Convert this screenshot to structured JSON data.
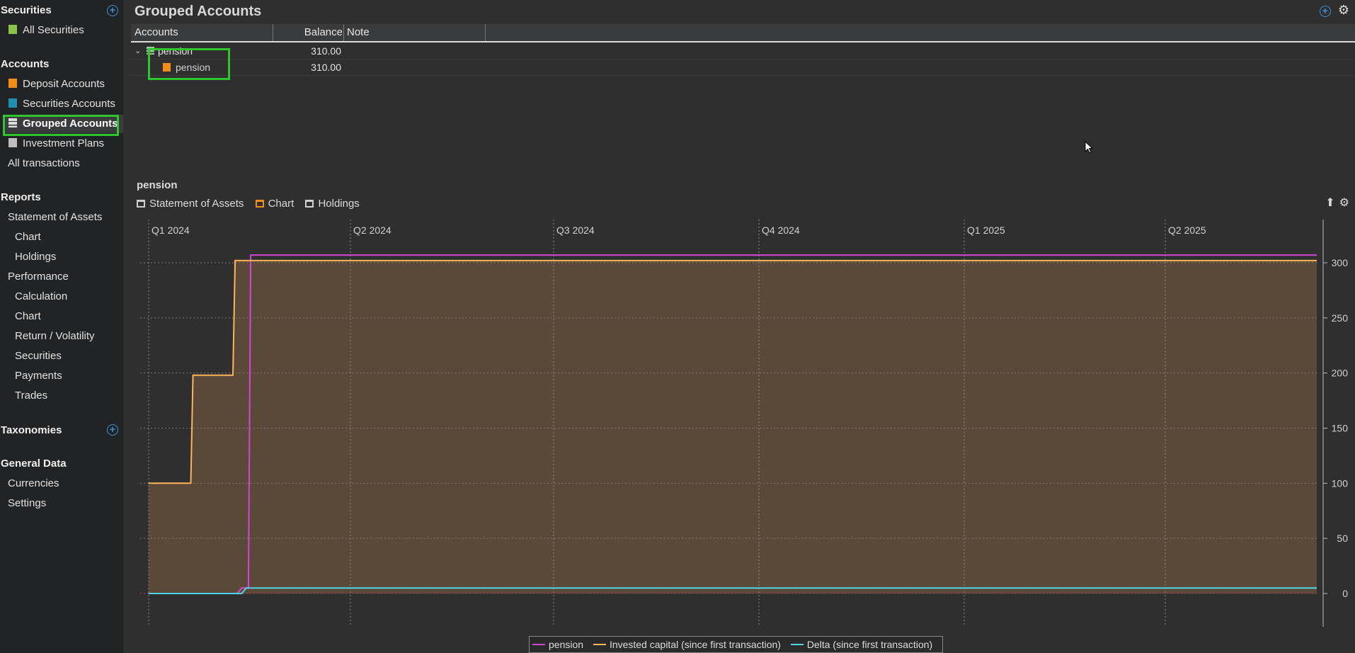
{
  "sidebar": {
    "securities": {
      "title": "Securities",
      "items": [
        "All Securities"
      ]
    },
    "accounts": {
      "title": "Accounts",
      "items": [
        "Deposit Accounts",
        "Securities Accounts",
        "Grouped Accounts",
        "Investment Plans",
        "All transactions"
      ]
    },
    "reports": {
      "title": "Reports",
      "items": [
        "Statement of Assets",
        "Chart",
        "Holdings",
        "Performance",
        "Calculation",
        "Chart",
        "Return / Volatility",
        "Securities",
        "Payments",
        "Trades"
      ]
    },
    "taxonomies": {
      "title": "Taxonomies"
    },
    "general": {
      "title": "General Data",
      "items": [
        "Currencies",
        "Settings"
      ]
    }
  },
  "main": {
    "title": "Grouped Accounts",
    "columns": [
      "Accounts",
      "Balance",
      "Note"
    ],
    "rows": [
      {
        "name": "pension",
        "balance": "310.00"
      },
      {
        "name": "pension",
        "balance": "310.00"
      }
    ],
    "section_label": "pension",
    "tabs": [
      "Statement of Assets",
      "Chart",
      "Holdings"
    ]
  },
  "colors": {
    "pension": "#d646d6",
    "invested": "#ffb35a",
    "delta": "#4fd6e6",
    "fill": "#5a4838"
  },
  "chart_data": {
    "type": "line",
    "x_ticks": [
      "Q1 2024",
      "Q2 2024",
      "Q3 2024",
      "Q4 2024",
      "Q1 2025",
      "Q2 2025"
    ],
    "y_ticks": [
      0,
      50,
      100,
      150,
      200,
      250,
      300
    ],
    "ylim": [
      0,
      300
    ],
    "series": [
      {
        "name": "pension",
        "points": [
          [
            "2024-01-01",
            0
          ],
          [
            "2024-02-10",
            0
          ],
          [
            "2024-02-12",
            5
          ],
          [
            "2024-02-15",
            5
          ],
          [
            "2024-02-16",
            307
          ],
          [
            "2025-06-30",
            307
          ]
        ]
      },
      {
        "name": "Invested capital (since first transaction)",
        "points": [
          [
            "2024-01-01",
            100
          ],
          [
            "2024-01-20",
            100
          ],
          [
            "2024-01-21",
            198
          ],
          [
            "2024-02-08",
            198
          ],
          [
            "2024-02-09",
            302
          ],
          [
            "2025-06-30",
            302
          ]
        ]
      },
      {
        "name": "Delta (since first transaction)",
        "points": [
          [
            "2024-01-01",
            0
          ],
          [
            "2024-02-12",
            0
          ],
          [
            "2024-02-14",
            5
          ],
          [
            "2025-06-30",
            5
          ]
        ]
      }
    ]
  }
}
